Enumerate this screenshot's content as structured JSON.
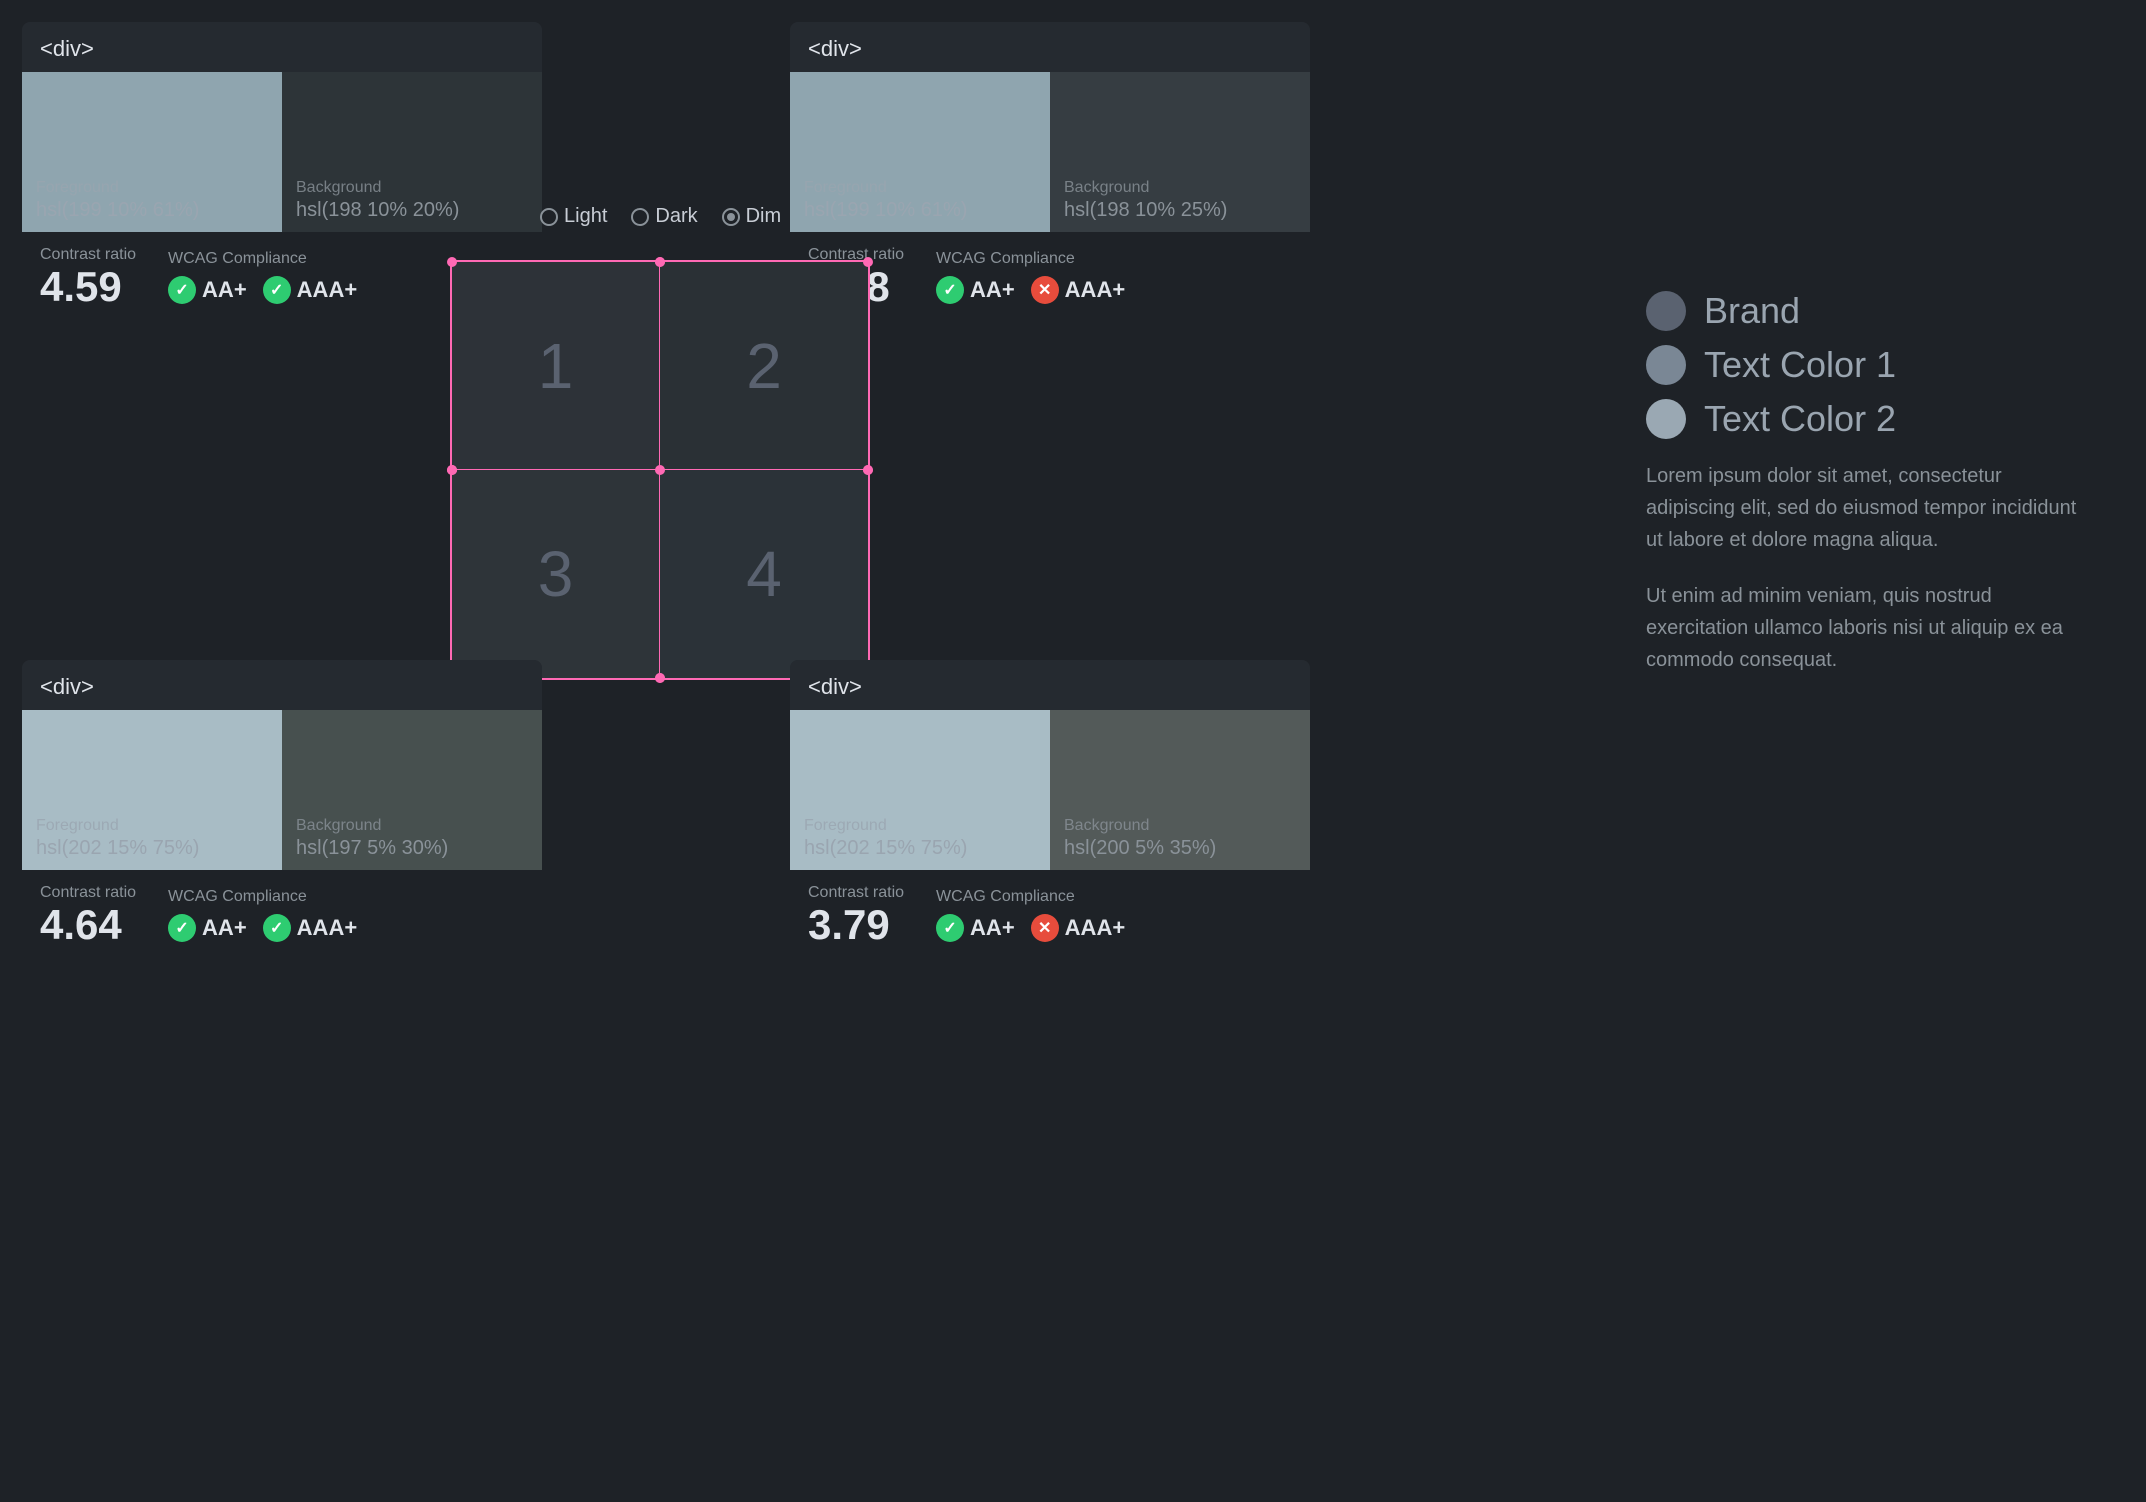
{
  "cards": {
    "top_left": {
      "tag": "<div>",
      "fg_color": "hsl(199 10% 61%)",
      "bg_color": "hsl(198 10% 20%)",
      "fg_swatch": "#8fa5af",
      "bg_swatch": "#2d3438",
      "contrast_ratio": "4.59",
      "wcag_label": "WCAG Compliance",
      "contrast_label": "Contrast ratio",
      "aa_label": "AA+",
      "aaa_label": "AAA+",
      "aa_pass": true,
      "aaa_pass": true
    },
    "top_right": {
      "tag": "<div>",
      "fg_color": "hsl(199 10% 61%)",
      "bg_color": "hsl(198 10% 25%)",
      "fg_swatch": "#8fa5af",
      "bg_swatch": "#363d42",
      "contrast_ratio": "3.78",
      "wcag_label": "WCAG Compliance",
      "contrast_label": "Contrast ratio",
      "aa_label": "AA+",
      "aaa_label": "AAA+",
      "aa_pass": true,
      "aaa_pass": false
    },
    "bottom_left": {
      "tag": "<div>",
      "fg_color": "hsl(202 15% 75%)",
      "bg_color": "hsl(197 5% 30%)",
      "fg_swatch": "#a8bcc5",
      "bg_swatch": "#47504f",
      "contrast_ratio": "4.64",
      "wcag_label": "WCAG Compliance",
      "contrast_label": "Contrast ratio",
      "aa_label": "AA+",
      "aaa_label": "AAA+",
      "aa_pass": true,
      "aaa_pass": true
    },
    "bottom_right": {
      "tag": "<div>",
      "fg_color": "hsl(202 15% 75%)",
      "bg_color": "hsl(200 5% 35%)",
      "fg_swatch": "#a8bcc5",
      "bg_swatch": "#535a59",
      "contrast_ratio": "3.79",
      "wcag_label": "WCAG Compliance",
      "contrast_label": "Contrast ratio",
      "aa_label": "AA+",
      "aaa_label": "AAA+",
      "aa_pass": true,
      "aaa_pass": false
    }
  },
  "theme": {
    "options": [
      "Light",
      "Dark",
      "Dim"
    ],
    "selected": "Dim"
  },
  "grid": {
    "cells": [
      "1",
      "2",
      "3",
      "4"
    ]
  },
  "legend": {
    "items": [
      {
        "label": "Brand",
        "color": "#5a6270"
      },
      {
        "label": "Text Color 1",
        "color": "#7a8795"
      },
      {
        "label": "Text Color 2",
        "color": "#9aa8b3"
      }
    ]
  },
  "body_text": {
    "paragraph1": "Lorem ipsum dolor sit amet, consectetur adipiscing elit, sed do eiusmod tempor incididunt ut labore et dolore magna aliqua.",
    "paragraph2": "Ut enim ad minim veniam, quis nostrud exercitation ullamco laboris nisi ut aliquip ex ea commodo consequat."
  }
}
